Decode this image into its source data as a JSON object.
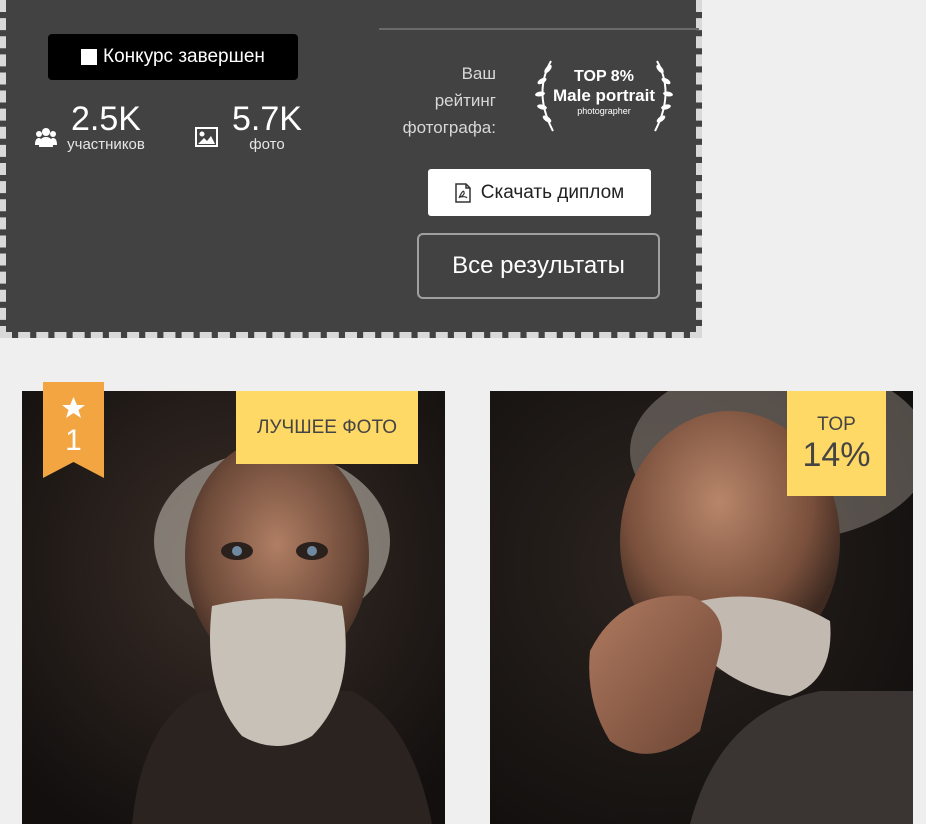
{
  "contest": {
    "status_label": "Конкурс завершен",
    "participants": {
      "value": "2.5K",
      "label": "участников"
    },
    "photos": {
      "value": "5.7K",
      "label": "фото"
    }
  },
  "rating": {
    "label_line1": "Ваш",
    "label_line2": "рейтинг",
    "label_line3": "фотографа:",
    "badge_line1": "TOP 8%",
    "badge_line2": "Male portrait",
    "badge_line3": "photographer"
  },
  "actions": {
    "download_label": "Скачать диплом",
    "results_label": "Все результаты"
  },
  "photos": [
    {
      "rank": "1",
      "tag": "ЛУЧШЕЕ ФОТО"
    },
    {
      "tag_line1": "TOP",
      "tag_line2": "14%"
    }
  ],
  "colors": {
    "panel": "#424242",
    "tag": "#ffd966",
    "ribbon": "#f2a541"
  }
}
